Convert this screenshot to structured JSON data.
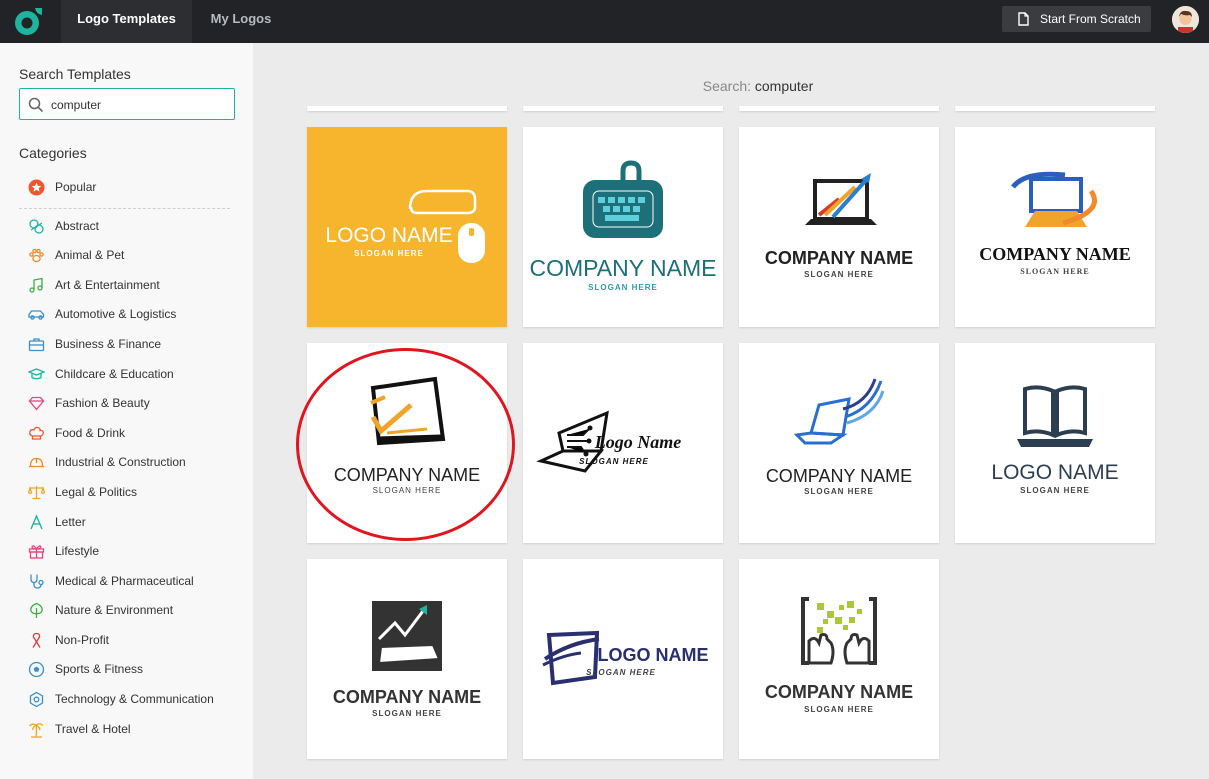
{
  "header": {
    "tabs": [
      {
        "label": "Logo Templates",
        "active": true
      },
      {
        "label": "My Logos",
        "active": false
      }
    ],
    "start_button": "Start From Scratch",
    "brand_color": "#1fb3a0"
  },
  "sidebar": {
    "search_title": "Search Templates",
    "search_value": "computer",
    "categories_title": "Categories",
    "popular": {
      "label": "Popular",
      "icon": "star-icon"
    },
    "categories": [
      {
        "label": "Abstract",
        "icon": "abstract-icon"
      },
      {
        "label": "Animal & Pet",
        "icon": "paw-icon"
      },
      {
        "label": "Art & Entertainment",
        "icon": "music-note-icon"
      },
      {
        "label": "Automotive & Logistics",
        "icon": "car-icon"
      },
      {
        "label": "Business & Finance",
        "icon": "briefcase-icon"
      },
      {
        "label": "Childcare & Education",
        "icon": "graduation-cap-icon"
      },
      {
        "label": "Fashion & Beauty",
        "icon": "diamond-icon"
      },
      {
        "label": "Food & Drink",
        "icon": "chef-hat-icon"
      },
      {
        "label": "Industrial & Construction",
        "icon": "hard-hat-icon"
      },
      {
        "label": "Legal & Politics",
        "icon": "scales-icon"
      },
      {
        "label": "Letter",
        "icon": "letter-a-icon"
      },
      {
        "label": "Lifestyle",
        "icon": "gift-icon"
      },
      {
        "label": "Medical & Pharmaceutical",
        "icon": "stethoscope-icon"
      },
      {
        "label": "Nature & Environment",
        "icon": "tree-icon"
      },
      {
        "label": "Non-Profit",
        "icon": "ribbon-icon"
      },
      {
        "label": "Sports & Fitness",
        "icon": "soccer-ball-icon"
      },
      {
        "label": "Technology & Communication",
        "icon": "chip-icon"
      },
      {
        "label": "Travel & Hotel",
        "icon": "palm-tree-icon"
      }
    ]
  },
  "main": {
    "search_prefix": "Search:",
    "search_query": "computer",
    "templates": [
      {
        "name": "LOGO NAME",
        "slogan": "SLOGAN HERE",
        "icon": "computer-mouse-icon"
      },
      {
        "name": "COMPANY NAME",
        "slogan": "SLOGAN HERE",
        "icon": "keyboard-icon"
      },
      {
        "name": "COMPANY NAME",
        "slogan": "SLOGAN HERE",
        "icon": "laptop-growth-arrows-icon"
      },
      {
        "name": "COMPANY NAME",
        "slogan": "SLOGAN HERE",
        "icon": "laptop-orbit-icon"
      },
      {
        "name": "COMPANY NAME",
        "slogan": "SLOGAN HERE",
        "icon": "monitor-check-icon"
      },
      {
        "name": "Logo Name",
        "slogan": "SLOGAN HERE",
        "icon": "laptop-circuit-icon"
      },
      {
        "name": "COMPANY NAME",
        "slogan": "SLOGAN HERE",
        "icon": "laptop-wave-icon"
      },
      {
        "name": "LOGO NAME",
        "slogan": "SLOGAN HERE",
        "icon": "laptop-book-icon"
      },
      {
        "name": "COMPANY NAME",
        "slogan": "SLOGAN HERE",
        "icon": "laptop-chart-icon"
      },
      {
        "name": "LOGO NAME",
        "slogan": "SLOGAN HERE",
        "icon": "laptop-swoosh-icon"
      },
      {
        "name": "COMPANY NAME",
        "slogan": "SLOGAN HERE",
        "icon": "hands-code-icon"
      }
    ]
  }
}
